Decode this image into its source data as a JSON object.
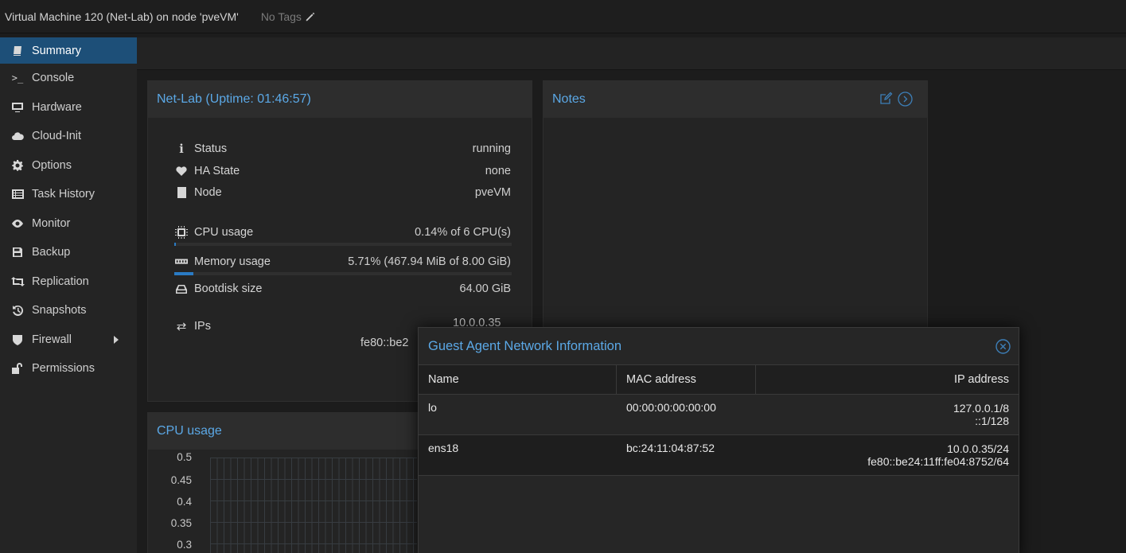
{
  "header": {
    "title": "Virtual Machine 120 (Net-Lab) on node 'pveVM'",
    "tags_label": "No Tags"
  },
  "sidebar": {
    "items": [
      {
        "label": "Summary",
        "icon": "book-icon"
      },
      {
        "label": "Console",
        "icon": "terminal-icon"
      },
      {
        "label": "Hardware",
        "icon": "monitor-icon"
      },
      {
        "label": "Cloud-Init",
        "icon": "cloud-icon"
      },
      {
        "label": "Options",
        "icon": "gear-icon"
      },
      {
        "label": "Task History",
        "icon": "list-icon"
      },
      {
        "label": "Monitor",
        "icon": "eye-icon"
      },
      {
        "label": "Backup",
        "icon": "floppy-icon"
      },
      {
        "label": "Replication",
        "icon": "retweet-icon"
      },
      {
        "label": "Snapshots",
        "icon": "history-icon"
      },
      {
        "label": "Firewall",
        "icon": "shield-icon"
      },
      {
        "label": "Permissions",
        "icon": "unlock-icon"
      }
    ]
  },
  "summary": {
    "title": "Net-Lab (Uptime: 01:46:57)",
    "status_label": "Status",
    "status_value": "running",
    "ha_label": "HA State",
    "ha_value": "none",
    "node_label": "Node",
    "node_value": "pveVM",
    "cpu_label": "CPU usage",
    "cpu_value": "0.14% of 6 CPU(s)",
    "cpu_fraction": 0.0014,
    "mem_label": "Memory usage",
    "mem_value": "5.71% (467.94 MiB of 8.00 GiB)",
    "mem_fraction": 0.0571,
    "disk_label": "Bootdisk size",
    "disk_value": "64.00 GiB",
    "ips_label": "IPs",
    "ips_value_1": "10.0.0.35",
    "ips_value_2": "fe80::be2"
  },
  "notes": {
    "title": "Notes"
  },
  "cpu_panel": {
    "title": "CPU usage",
    "yticks": [
      "0.5",
      "0.45",
      "0.4",
      "0.35",
      "0.3"
    ]
  },
  "modal": {
    "title": "Guest Agent Network Information",
    "columns": [
      "Name",
      "MAC address",
      "IP address"
    ],
    "rows": [
      {
        "name": "lo",
        "mac": "00:00:00:00:00:00",
        "ip1": "127.0.0.1/8",
        "ip2": "::1/128"
      },
      {
        "name": "ens18",
        "mac": "bc:24:11:04:87:52",
        "ip1": "10.0.0.35/24",
        "ip2": "fe80::be24:11ff:fe04:8752/64"
      }
    ]
  },
  "colors": {
    "accent": "#5ba8e6",
    "active_nav": "#1d4f78",
    "bar_fill": "#2a7bc4"
  }
}
